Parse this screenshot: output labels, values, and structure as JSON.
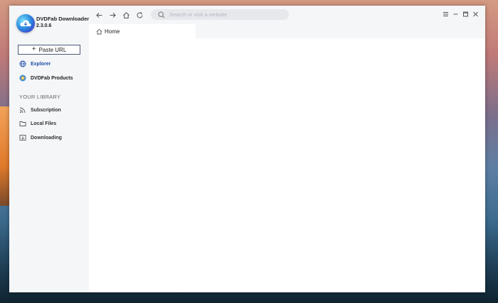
{
  "app": {
    "name": "DVDFab Downloader",
    "version": "2.3.0.6"
  },
  "sidebar": {
    "paste_url_label": "Paste URL",
    "items": [
      {
        "label": "Explorer",
        "icon": "globe-icon",
        "active": true
      },
      {
        "label": "DVDFab Products",
        "icon": "dvdfab-products-icon",
        "active": false
      }
    ],
    "library_title": "YOUR LIBRARY",
    "library_items": [
      {
        "label": "Subscription",
        "icon": "rss-icon"
      },
      {
        "label": "Local Files",
        "icon": "folder-icon"
      },
      {
        "label": "Downloading",
        "icon": "download-list-icon"
      }
    ]
  },
  "toolbar": {
    "search_placeholder": "Search or visit a website"
  },
  "tabs": [
    {
      "label": "Home",
      "icon": "home-icon"
    }
  ],
  "colors": {
    "accent": "#1f4fa8",
    "sidebar_bg": "#f5f6f8",
    "search_bg": "#e6e8ec"
  }
}
